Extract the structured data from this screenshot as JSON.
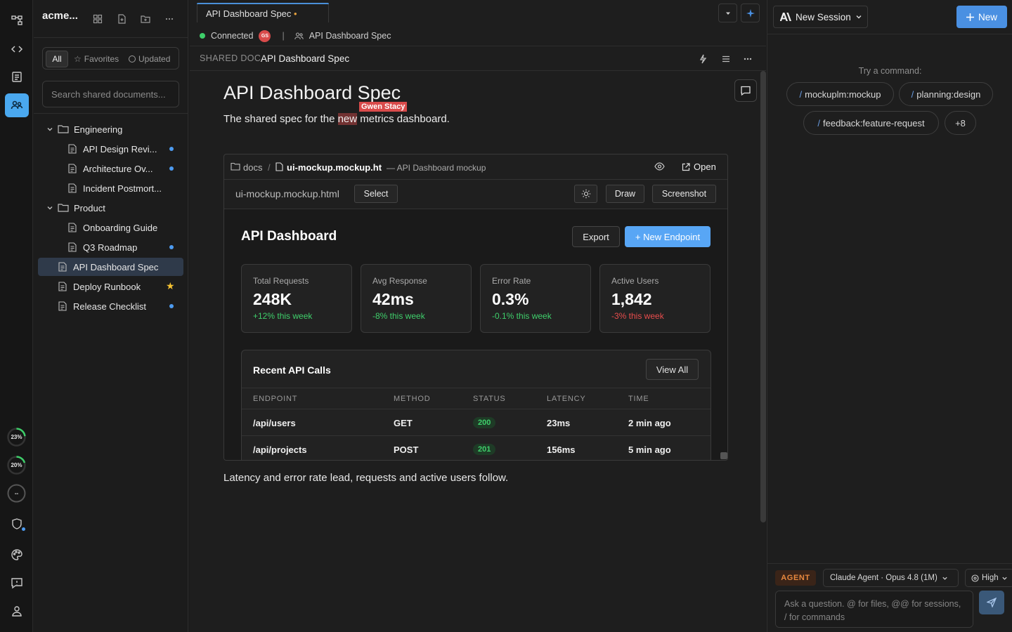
{
  "sidebar": {
    "workspace": "acme...",
    "filters": {
      "all": "All",
      "favorites": "Favorites",
      "updated": "Updated"
    },
    "search_placeholder": "Search shared documents...",
    "folders": [
      {
        "label": "Engineering",
        "items": [
          "API Design Revi...",
          "Architecture Ov...",
          "Incident Postmort..."
        ]
      },
      {
        "label": "Product",
        "items": [
          "Onboarding Guide",
          "Q3 Roadmap"
        ]
      }
    ],
    "root_items": [
      "API Dashboard Spec",
      "Deploy Runbook",
      "Release Checklist"
    ]
  },
  "rail": {
    "usage": [
      "23%",
      "20%",
      "--"
    ]
  },
  "tabs": [
    {
      "label": "API Dashboard Spec",
      "modified": "•"
    }
  ],
  "status": {
    "connection": "Connected",
    "avatar_initials": "GS",
    "separator": "|",
    "doc_name": "API Dashboard Spec"
  },
  "doc_header": {
    "label": "SHARED DOC",
    "title": "API Dashboard Spec"
  },
  "doc": {
    "title": "API Dashboard Spec",
    "collaborator_cursor": "Gwen Stacy",
    "subtitle_pre": "The shared spec for the ",
    "subtitle_highlight": "new",
    "subtitle_post": " metrics dashboard.",
    "footer": "Latency and error rate lead, requests and active users follow."
  },
  "embed": {
    "path_root": "docs",
    "path_sep": "/",
    "file": "ui-mockup.mockup.ht",
    "desc": "— API Dashboard mockup",
    "open_label": "Open",
    "filename": "ui-mockup.mockup.html",
    "select_label": "Select",
    "draw_label": "Draw",
    "screenshot_label": "Screenshot"
  },
  "mockup": {
    "title": "API Dashboard",
    "export_label": "Export",
    "new_endpoint_label": "+ New Endpoint",
    "cards": [
      {
        "label": "Total Requests",
        "value": "248K",
        "delta": "+12% this week",
        "trend": "up"
      },
      {
        "label": "Avg Response",
        "value": "42ms",
        "delta": "-8% this week",
        "trend": "up"
      },
      {
        "label": "Error Rate",
        "value": "0.3%",
        "delta": "-0.1% this week",
        "trend": "up"
      },
      {
        "label": "Active Users",
        "value": "1,842",
        "delta": "-3% this week",
        "trend": "down"
      }
    ],
    "calls_title": "Recent API Calls",
    "view_all_label": "View All",
    "columns": [
      "ENDPOINT",
      "METHOD",
      "STATUS",
      "LATENCY",
      "TIME"
    ],
    "rows": [
      {
        "endpoint": "/api/users",
        "method": "GET",
        "status": "200",
        "latency": "23ms",
        "time": "2 min ago"
      },
      {
        "endpoint": "/api/projects",
        "method": "POST",
        "status": "201",
        "latency": "156ms",
        "time": "5 min ago"
      }
    ]
  },
  "right": {
    "new_session_label": "New Session",
    "new_label": "New",
    "try_label": "Try a command:",
    "commands": [
      "mockuplm:mockup",
      "planning:design",
      "feedback:feature-request"
    ],
    "slash": "/",
    "more": "+8",
    "agent_tag": "AGENT",
    "model": "Claude Agent · Opus 4.8 (1M)",
    "effort": "High",
    "ask_placeholder": "Ask a question. @ for files, @@ for sessions, / for commands"
  },
  "colors": {
    "accent": "#4a90e2",
    "positive": "#3fcf6b",
    "negative": "#e84d4d",
    "cursor": "#d94b4b",
    "agent": "#e8893e"
  }
}
